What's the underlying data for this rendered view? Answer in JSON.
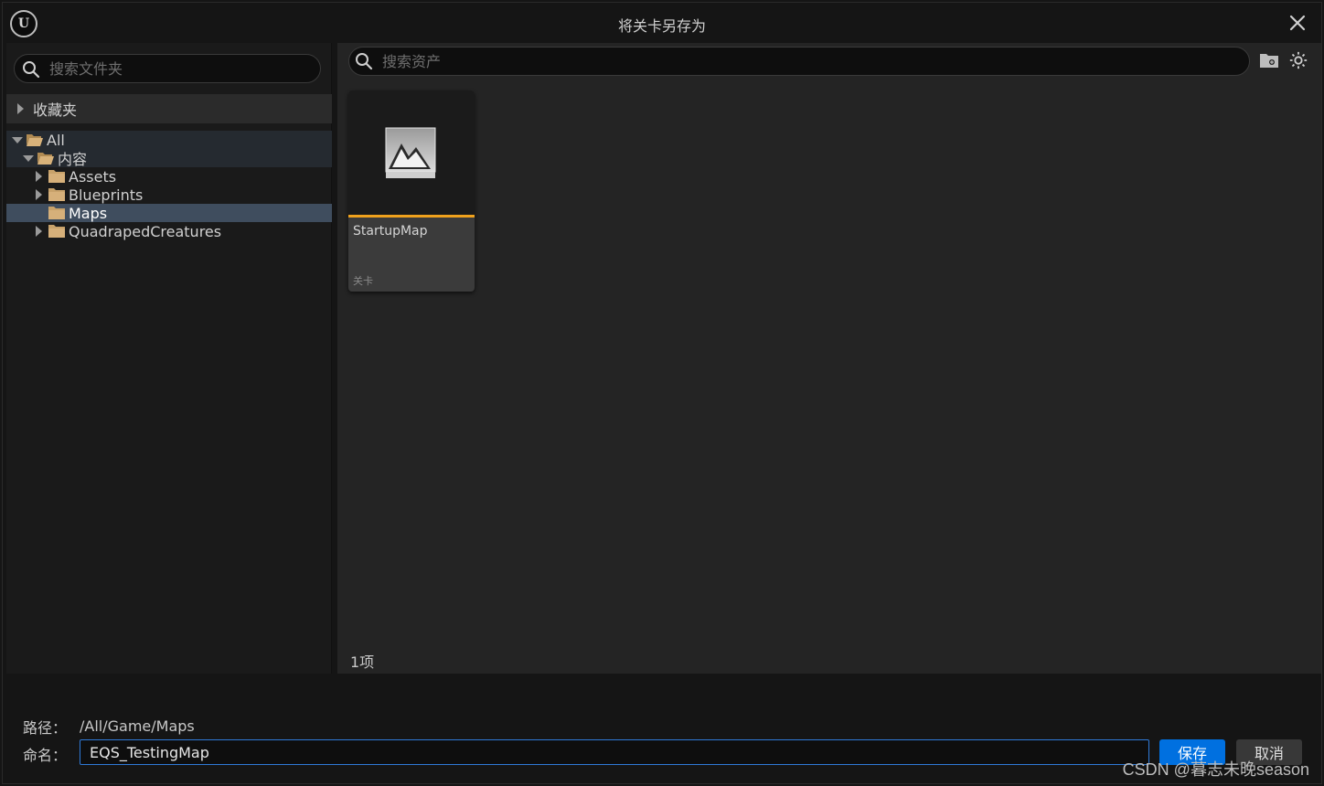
{
  "window": {
    "title": "将关卡另存为"
  },
  "left": {
    "search_placeholder": "搜索文件夹",
    "favorites_label": "收藏夹",
    "tree": {
      "all": "All",
      "content": "内容",
      "assets": "Assets",
      "blueprints": "Blueprints",
      "maps": "Maps",
      "quadraped": "QuadrapedCreatures"
    }
  },
  "right": {
    "search_placeholder": "搜索资产",
    "asset": {
      "name": "StartupMap",
      "type": "关卡"
    },
    "item_count": "1项"
  },
  "bottom": {
    "path_label": "路径：",
    "path_value": "/All/Game/Maps",
    "name_label": "命名：",
    "name_value": "EQS_TestingMap",
    "save_label": "保存",
    "cancel_label": "取消"
  },
  "watermark": "CSDN @暮志未晚season",
  "colors": {
    "accent_orange": "#f0a21d",
    "primary_blue": "#0070e0",
    "selected_row": "#3f4d5e",
    "folder": "#c8a26a"
  }
}
